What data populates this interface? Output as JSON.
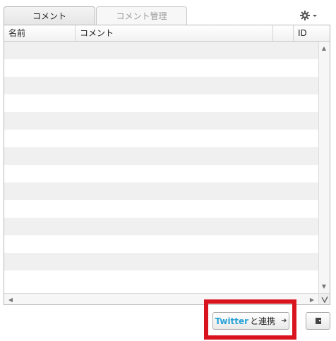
{
  "tabs": [
    {
      "label": "コメント",
      "active": true
    },
    {
      "label": "コメント管理",
      "active": false
    }
  ],
  "toolbar": {
    "settings_icon": "gear-icon",
    "dropdown_icon": "chevron-down-icon"
  },
  "table": {
    "columns": [
      "名前",
      "コメント",
      "",
      "ID"
    ],
    "row_count": 14,
    "row_stripe_color": "#f0f0f0"
  },
  "twitter_button": {
    "brand": "Twitter",
    "suffix": "と連携",
    "icon": "arrow-right-icon",
    "brand_color": "#28a3d6"
  },
  "highlight_color": "#d9141e"
}
